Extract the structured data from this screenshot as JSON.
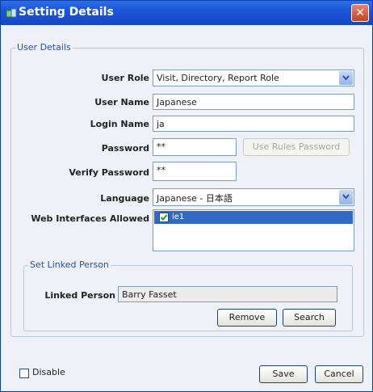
{
  "window": {
    "title": "Setting Details",
    "close_icon": "close-icon"
  },
  "user_details": {
    "group_label": "User Details",
    "user_role": {
      "label": "User Role",
      "value": "Visit, Directory, Report Role"
    },
    "user_name": {
      "label": "User Name",
      "value": "Japanese"
    },
    "login_name": {
      "label": "Login Name",
      "value": "ja"
    },
    "password": {
      "label": "Password",
      "value": "**",
      "button": "Use Rules Password"
    },
    "verify_password": {
      "label": "Verify Password",
      "value": "**"
    },
    "language": {
      "label": "Language",
      "value": "Japanese - 日本語"
    },
    "web_interfaces": {
      "label": "Web Interfaces Allowed",
      "items": [
        {
          "label": "ie1",
          "checked": true
        }
      ]
    }
  },
  "linked_person": {
    "group_label": "Set Linked Person",
    "label": "Linked Person",
    "value": "Barry Fasset",
    "remove_button": "Remove",
    "search_button": "Search"
  },
  "footer": {
    "disable_label": "Disable",
    "save_button": "Save",
    "cancel_button": "Cancel"
  },
  "colors": {
    "title_bar": "#1c55d8",
    "accent_blue": "#2a4fa6",
    "selection": "#316ac5"
  }
}
